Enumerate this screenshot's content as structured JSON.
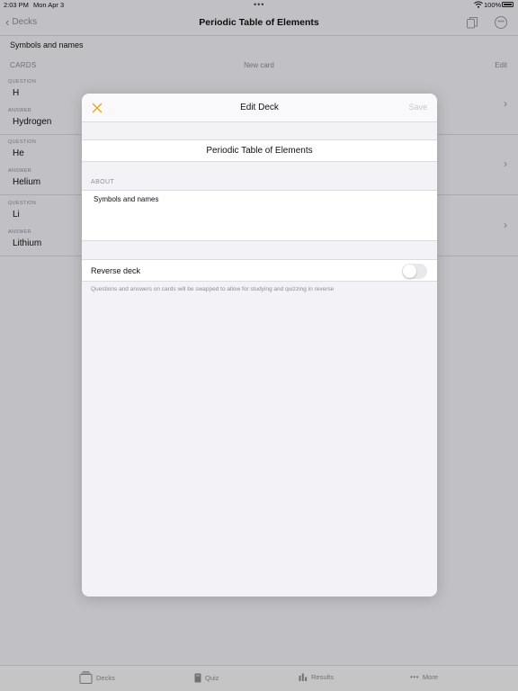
{
  "status": {
    "time": "2:03 PM",
    "date": "Mon Apr 3",
    "battery": "100%"
  },
  "nav": {
    "back_label": "Decks",
    "title": "Periodic Table of Elements"
  },
  "deck": {
    "about": "Symbols and names"
  },
  "cards_section": {
    "header": "CARDS",
    "new_card": "New card",
    "edit": "Edit"
  },
  "cards": [
    {
      "question_label": "QUESTION",
      "question": "H",
      "answer_label": "ANSWER",
      "answer": "Hydrogen"
    },
    {
      "question_label": "QUESTION",
      "question": "He",
      "answer_label": "ANSWER",
      "answer": "Helium"
    },
    {
      "question_label": "QUESTION",
      "question": "Li",
      "answer_label": "ANSWER",
      "answer": "Lithium"
    }
  ],
  "tabs": [
    {
      "label": "Decks",
      "icon": "decks-icon"
    },
    {
      "label": "Quiz",
      "icon": "quiz-icon"
    },
    {
      "label": "Results",
      "icon": "results-icon"
    },
    {
      "label": "More",
      "icon": "more-icon"
    }
  ],
  "modal": {
    "title": "Edit Deck",
    "save_label": "Save",
    "name_value": "Periodic Table of Elements",
    "about_label": "ABOUT",
    "about_value": "Symbols and names",
    "reverse_label": "Reverse deck",
    "reverse_on": false,
    "reverse_help": "Questions and answers on cards will be swapped to allow for studying and quizzing in reverse"
  },
  "colors": {
    "accent": "#f0a31a",
    "muted": "#8e8e93",
    "disabled": "#c7c7cc"
  }
}
